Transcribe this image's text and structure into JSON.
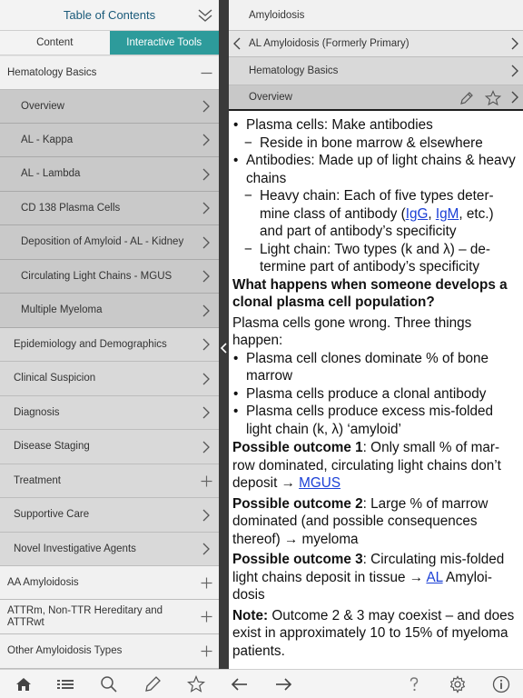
{
  "toc": {
    "title": "Table of Contents",
    "tabs": {
      "content": "Content",
      "tools": "Interactive Tools"
    }
  },
  "nav": [
    {
      "label": "Hematology Basics",
      "level": 0,
      "ctrl": "minus"
    },
    {
      "label": "Overview",
      "level": 2,
      "ctrl": "chevron"
    },
    {
      "label": "AL - Kappa",
      "level": 2,
      "ctrl": "chevron"
    },
    {
      "label": "AL - Lambda",
      "level": 2,
      "ctrl": "chevron"
    },
    {
      "label": "CD 138 Plasma Cells",
      "level": 2,
      "ctrl": "chevron"
    },
    {
      "label": "Deposition of Amyloid - AL - Kidney",
      "level": 2,
      "ctrl": "chevron"
    },
    {
      "label": "Circulating Light Chains - MGUS",
      "level": 2,
      "ctrl": "chevron"
    },
    {
      "label": "Multiple Myeloma",
      "level": 2,
      "ctrl": "chevron"
    },
    {
      "label": "Epidemiology and Demographics",
      "level": 1,
      "ctrl": "chevron"
    },
    {
      "label": "Clinical Suspicion",
      "level": 1,
      "ctrl": "chevron"
    },
    {
      "label": "Diagnosis",
      "level": 1,
      "ctrl": "chevron"
    },
    {
      "label": "Disease Staging",
      "level": 1,
      "ctrl": "chevron"
    },
    {
      "label": "Treatment",
      "level": 1,
      "ctrl": "plus"
    },
    {
      "label": "Supportive Care",
      "level": 1,
      "ctrl": "chevron"
    },
    {
      "label": "Novel Investigative Agents",
      "level": 1,
      "ctrl": "chevron"
    },
    {
      "label": "AA Amyloidosis",
      "level": 0,
      "ctrl": "plus"
    },
    {
      "label": "ATTRm, Non-TTR Hereditary and ATTRwt",
      "level": 0,
      "ctrl": "plus"
    },
    {
      "label": "Other Amyloidosis Types",
      "level": 0,
      "ctrl": "plus"
    }
  ],
  "breadcrumbs": [
    "Amyloidosis",
    "AL Amyloidosis (Formerly Primary)",
    "Hematology Basics",
    "Overview"
  ],
  "article": {
    "b_plasma": "Plasma cells: Make antibodies",
    "b_plasma_sub": "Reside in bone marrow & elsewhere",
    "b_antibodies": "Antibodies: Made up of light chains & heavy chains",
    "b_heavy_pre": "Heavy chain: Each of five types deter-mine class of antibody (",
    "link_igg": "IgG",
    "sep": ", ",
    "link_igm": "IgM",
    "b_heavy_post": ", etc.) and part of antibody’s specificity",
    "b_light": "Light chain: Two types (k and λ) – de-termine part of antibody’s specificity",
    "heading": "What happens when someone develops a clonal plasma cell population?",
    "intro": "Plasma cells gone wrong. Three things happen:",
    "happen_1": "Plasma cell clones dominate % of bone marrow",
    "happen_2": "Plasma cells produce a clonal antibody",
    "happen_3": "Plasma cells produce excess mis-folded light chain (k, λ) ‘amyloid’",
    "o1_label": "Possible outcome 1",
    "o1_text": ": Only small % of mar-row dominated, circulating light chains don’t deposit → ",
    "link_mgus": "MGUS",
    "o2_label": "Possible outcome 2",
    "o2_text": ": Large % of marrow dominated (and possible consequences thereof) → myeloma",
    "o3_label": "Possible outcome 3",
    "o3_text": ": Circulating mis-folded light chains deposit in tissue → ",
    "link_al": "AL",
    "o3_tail": " Amyloi-dosis",
    "note_label": "Note:",
    "note_text": " Outcome 2 & 3 may coexist – and does exist in approximately 10 to 15% of myeloma patients."
  },
  "toolbar": [
    "home-icon",
    "list-icon",
    "search-icon",
    "pencil-icon",
    "star-icon",
    "back-arrow-icon",
    "forward-arrow-icon",
    "help-icon",
    "gear-icon",
    "info-icon"
  ],
  "colors": {
    "accent": "#2d9b9b",
    "title": "#1a5a7a",
    "link": "#1a3fd6",
    "divider": "#3a3a3a"
  }
}
